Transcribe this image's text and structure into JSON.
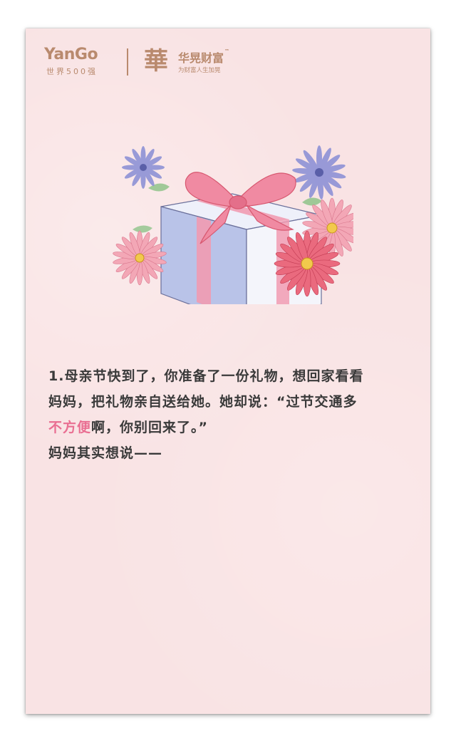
{
  "header": {
    "yango_logo": "YanGo",
    "yango_subtitle": "世界500强",
    "hua_mark": "華",
    "brand_name": "华晃财富",
    "trademark": "™",
    "brand_slogan": "为财富人生加晃"
  },
  "illustration": {
    "icon": "gift-box-with-flowers"
  },
  "story": {
    "line1": "1.母亲节快到了，你准备了一份礼物，想回家看看",
    "line2": "妈妈，把礼物亲自送给她。她却说：“过节交通多",
    "line3_highlight": "不方便",
    "line3_rest": "啊，你别回来了。”",
    "line4": "妈妈其实想说——"
  },
  "colors": {
    "background": "#f9e3e4",
    "brand": "#b98a6e",
    "text": "#3a3a3a",
    "highlight": "#e96f92"
  }
}
